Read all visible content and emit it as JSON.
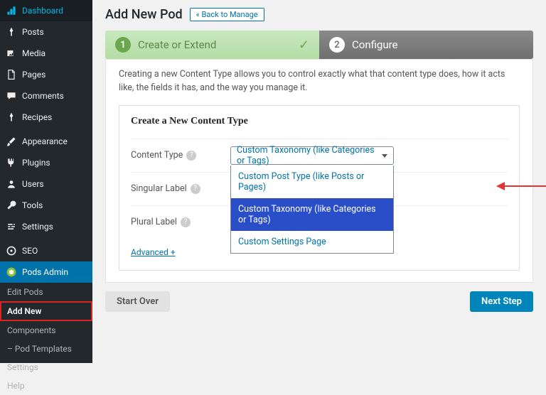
{
  "sidebar": {
    "main": [
      {
        "icon": "dashboard",
        "label": "Dashboard"
      },
      {
        "icon": "pin",
        "label": "Posts"
      },
      {
        "icon": "media",
        "label": "Media"
      },
      {
        "icon": "page",
        "label": "Pages"
      },
      {
        "icon": "comment",
        "label": "Comments"
      },
      {
        "icon": "pin",
        "label": "Recipes"
      }
    ],
    "secondary": [
      {
        "icon": "brush",
        "label": "Appearance"
      },
      {
        "icon": "plug",
        "label": "Plugins"
      },
      {
        "icon": "users",
        "label": "Users"
      },
      {
        "icon": "wrench",
        "label": "Tools"
      },
      {
        "icon": "settings",
        "label": "Settings"
      }
    ],
    "tertiary": [
      {
        "icon": "seo",
        "label": "SEO"
      },
      {
        "icon": "pods",
        "label": "Pods Admin",
        "active": true
      }
    ],
    "sub": [
      "Edit Pods",
      "Add New",
      "Components",
      "– Pod Templates",
      "Settings",
      "Help"
    ],
    "sub_current": 1
  },
  "page": {
    "title": "Add New Pod",
    "back": "« Back to Manage"
  },
  "wizard": {
    "step1": "Create or Extend",
    "step2": "Configure"
  },
  "intro": "Creating a new Content Type allows you to control exactly what that content type does, how it acts like, the fields it has, and the way you manage it.",
  "form": {
    "title": "Create a New Content Type",
    "content_type_label": "Content Type",
    "singular_label": "Singular Label",
    "plural_label": "Plural Label",
    "selected": "Custom Taxonomy (like Categories or Tags)",
    "options": [
      "Custom Post Type (like Posts or Pages)",
      "Custom Taxonomy (like Categories or Tags)",
      "Custom Settings Page"
    ],
    "highlight_index": 1,
    "advanced": "Advanced +"
  },
  "buttons": {
    "start_over": "Start Over",
    "next": "Next Step"
  }
}
